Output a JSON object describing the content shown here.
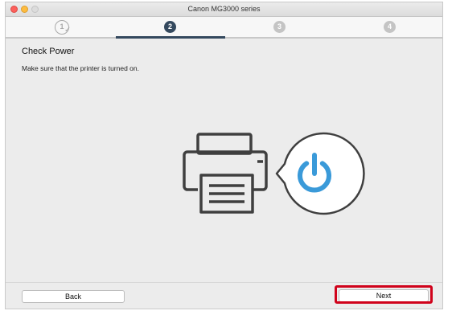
{
  "window": {
    "title": "Canon MG3000 series"
  },
  "steps": [
    {
      "label": "1",
      "state": "completed"
    },
    {
      "label": "2",
      "state": "current"
    },
    {
      "label": "3",
      "state": "upcoming"
    },
    {
      "label": "4",
      "state": "upcoming"
    }
  ],
  "main": {
    "heading": "Check Power",
    "message": "Make sure that the printer is turned on."
  },
  "footer": {
    "back_label": "Back",
    "next_label": "Next"
  },
  "colors": {
    "step_active": "#34495e",
    "step_inactive": "#c4c4c4",
    "power_icon": "#3a9ad9",
    "printer_outline": "#3f3f3f",
    "highlight": "#d0021b"
  },
  "icons": [
    "printer-icon",
    "power-icon",
    "checkmark-icon"
  ]
}
